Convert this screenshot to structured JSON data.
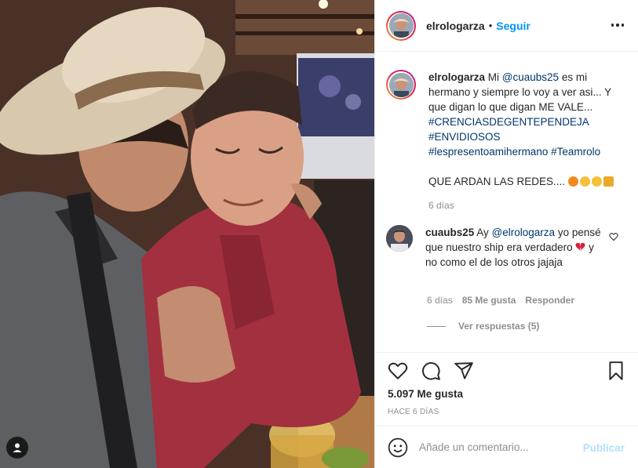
{
  "post": {
    "photo_alt": "",
    "header": {
      "username": "elrologarza",
      "separator": "•",
      "follow_label": "Seguir"
    },
    "caption": {
      "username": "elrologarza",
      "text_before_mention": "Mi ",
      "mention": "@cuaubs25",
      "text_after_mention": " es mi hermano y siempre lo voy a ver asi... Y que digan lo que digan ME VALE...",
      "hashtags": [
        "#CRENCIASDEGENTEPENDEJA",
        "#ENVIDIOSOS",
        "#lespresentoamihermano",
        "#Teamrolo"
      ],
      "closing": "QUE ARDAN LAS REDES....",
      "time": "6 días"
    },
    "comment": {
      "username": "cuaubs25",
      "text_before_mention": "Ay ",
      "mention": "@elrologarza",
      "text_middle": " yo pensé que nuestro ship era verdadero ",
      "text_after": " y no como el de los otros jajaja",
      "time": "6 días",
      "likes": "85 Me gusta",
      "reply_label": "Responder",
      "view_replies": "Ver respuestas (5)"
    },
    "actions": {
      "icons": [
        "heart-icon",
        "comment-icon",
        "share-icon",
        "bookmark-icon"
      ],
      "likes_count": "5.097 Me gusta",
      "posted_time": "HACE 6 DÍAS"
    },
    "add_comment": {
      "placeholder": "Añade un comentario...",
      "publish_label": "Publicar"
    }
  },
  "colors": {
    "link": "#0095f6",
    "mention": "#00376b",
    "muted": "#8e8e8e",
    "publish_disabled": "#b2dffc"
  }
}
